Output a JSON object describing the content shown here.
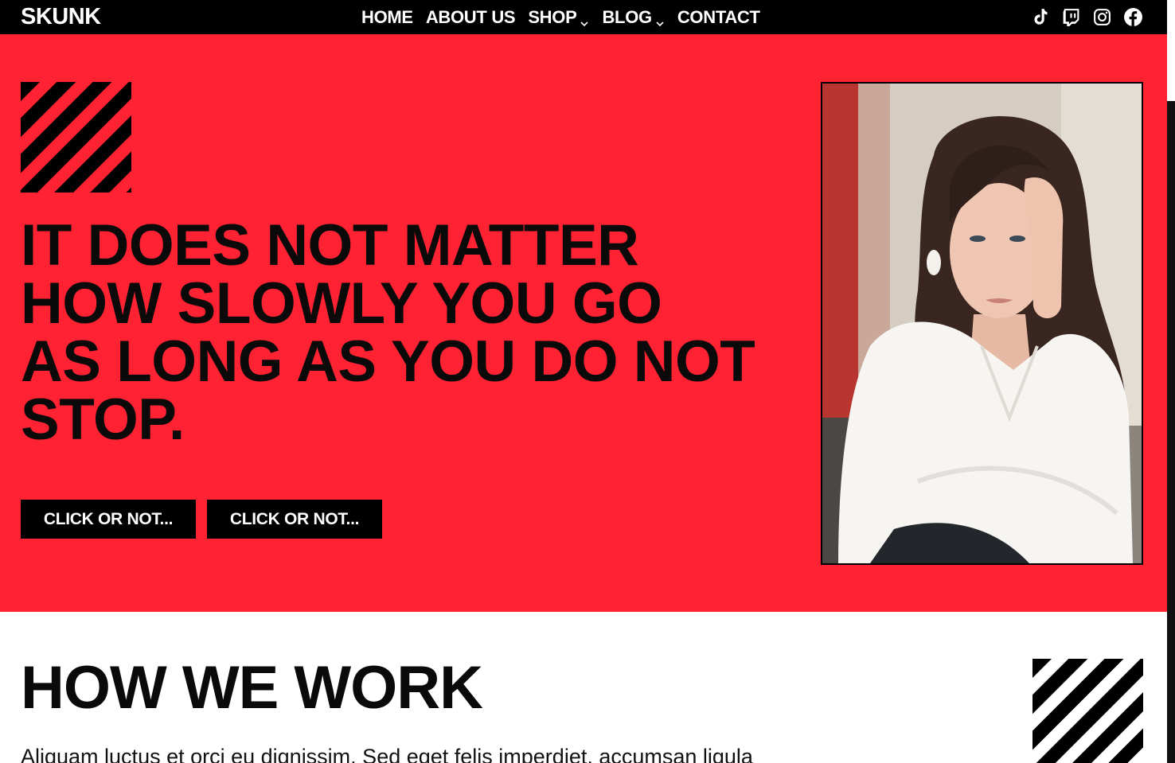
{
  "header": {
    "logo": "SKUNK",
    "nav": [
      {
        "label": "HOME",
        "has_dropdown": false
      },
      {
        "label": "ABOUT US",
        "has_dropdown": false
      },
      {
        "label": "SHOP",
        "has_dropdown": true
      },
      {
        "label": "BLOG",
        "has_dropdown": true
      },
      {
        "label": "CONTACT",
        "has_dropdown": false
      }
    ],
    "social_icons": [
      "tiktok-icon",
      "twitch-icon",
      "instagram-icon",
      "facebook-icon"
    ]
  },
  "hero": {
    "heading_lines": [
      "IT DOES NOT MATTER",
      "HOW SLOWLY YOU GO",
      "AS LONG AS YOU DO NOT",
      "STOP."
    ],
    "buttons": [
      {
        "label": "CLICK OR NOT..."
      },
      {
        "label": "CLICK OR NOT..."
      }
    ],
    "background_color": "#ff2233"
  },
  "section2": {
    "heading": "HOW WE WORK",
    "body": "Aliquam luctus et orci eu dignissim. Sed eget felis imperdiet, accumsan ligula"
  },
  "colors": {
    "accent": "#ff2233",
    "dark": "#000000",
    "light": "#ffffff"
  }
}
